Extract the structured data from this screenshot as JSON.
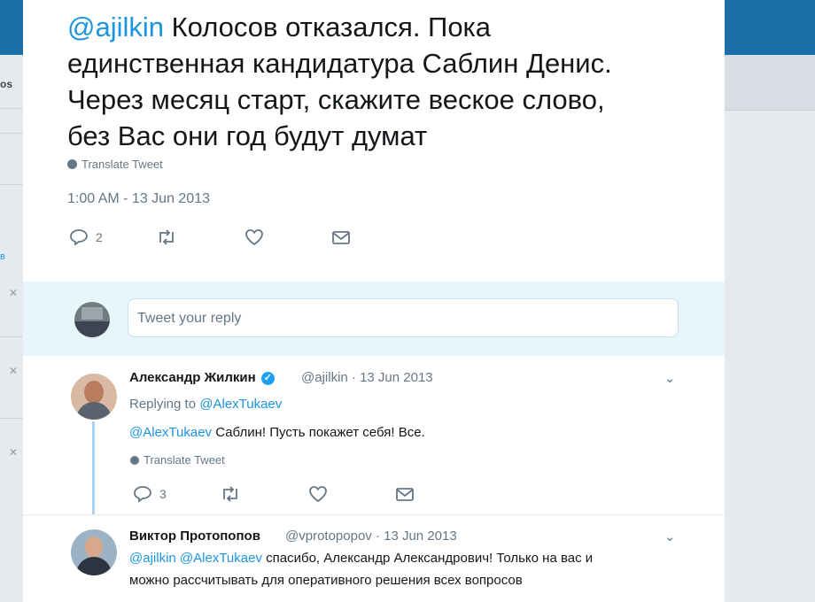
{
  "background": {
    "left_labels": [
      "os",
      "в"
    ]
  },
  "tweet": {
    "mention": "@ajilkin",
    "text_rest": "Колосов отказался. Пока",
    "line2": "единственная кандидатура Саблин Денис.",
    "line3": "Через месяц старт, скажите веское слово,",
    "line4": "без Вас они год будут думат",
    "translate": "Translate Tweet",
    "timestamp": "1:00 AM - 13 Jun 2013",
    "reply_count": "2"
  },
  "reply_box": {
    "placeholder": "Tweet your reply"
  },
  "replies": [
    {
      "name": "Александр Жилкин",
      "handle_date": "@ajilkin · 13 Jun 2013",
      "replying_label": "Replying to",
      "replying_to": "@AlexTukaev",
      "mention": "@AlexTukaev",
      "text": "Саблин! Пусть покажет себя! Все.",
      "translate": "Translate Tweet",
      "reply_count": "3"
    },
    {
      "name": "Виктор Протопопов",
      "handle_date": "@vprotopopov · 13 Jun 2013",
      "mention1": "@ajilkin",
      "mention2": "@AlexTukaev",
      "text_line1": "спасибо, Александр Александрович! Только на вас и",
      "text_line2": "можно рассчитывать для оперативного решения всех вопросов"
    }
  ],
  "colors": {
    "accent": "#1b95e0",
    "topbar": "#1b6fa8",
    "text_gray": "#657786"
  }
}
